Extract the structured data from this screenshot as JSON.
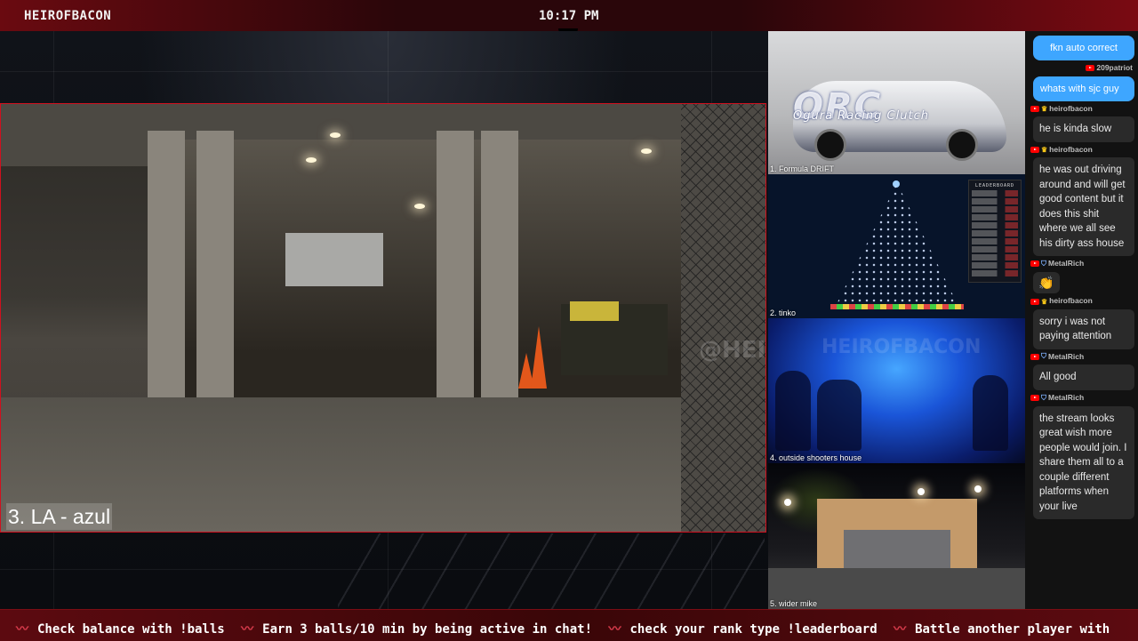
{
  "header": {
    "channel": "HEIROFBACON",
    "time": "10:17 PM"
  },
  "main_feed": {
    "caption": "3. LA - azul",
    "watermark": "@HEIROFBACON"
  },
  "side_feeds": [
    {
      "label": "1. Formula DRIFT",
      "logo": "ORC",
      "logo_sub": "Ogura Racing Clutch"
    },
    {
      "label": "2. tinko",
      "board_title": "LEADERBOARD"
    },
    {
      "label": "4. outside shooters house",
      "watermark": "HEIROFBACON"
    },
    {
      "label": "5. wider mike"
    }
  ],
  "chat": {
    "messages": [
      {
        "type": "self",
        "text": "fkn auto correct",
        "author": "209patriot"
      },
      {
        "type": "self",
        "text": "whats with sjc guy"
      },
      {
        "type": "other",
        "author": "heirofbacon",
        "badge": "crown",
        "text": "he is kinda slow"
      },
      {
        "type": "other",
        "author": "heirofbacon",
        "badge": "crown",
        "text": "he was out driving around and will get good content but it does this shit where we all see his dirty ass house"
      },
      {
        "type": "other",
        "author": "MetalRich",
        "badge": "shield",
        "text": "👏",
        "emoji": true
      },
      {
        "type": "other",
        "author": "heirofbacon",
        "badge": "crown",
        "text": "sorry i was not paying attention"
      },
      {
        "type": "other",
        "author": "MetalRich",
        "badge": "shield",
        "text": "All good"
      },
      {
        "type": "other",
        "author": "MetalRich",
        "badge": "shield",
        "text": "the stream looks great wish more people would join. I share them all to a couple different platforms when your live"
      }
    ]
  },
  "ticker": {
    "items": [
      "Check balance with !balls",
      "Earn 3 balls/10 min by being active in chat!",
      "check your rank type !leaderboard",
      "Battle another player with"
    ]
  },
  "colors": {
    "accent_red": "#d0101e",
    "chat_self": "#3ea6ff",
    "ticker_bg": "#5c0a10"
  }
}
